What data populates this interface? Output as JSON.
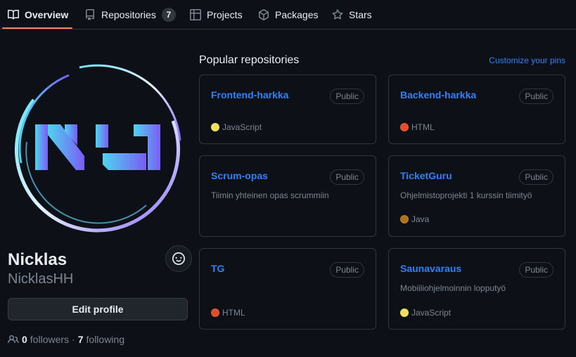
{
  "nav": {
    "tabs": [
      {
        "label": "Overview",
        "icon": "book-icon",
        "active": true
      },
      {
        "label": "Repositories",
        "icon": "repo-icon",
        "count": "7"
      },
      {
        "label": "Projects",
        "icon": "table-icon"
      },
      {
        "label": "Packages",
        "icon": "package-icon"
      },
      {
        "label": "Stars",
        "icon": "star-icon"
      }
    ]
  },
  "profile": {
    "avatar_text": "NJ",
    "name": "Nicklas",
    "username": "NicklasHH",
    "edit_button": "Edit profile",
    "followers_count": "0",
    "followers_label": "followers",
    "separator": "·",
    "following_count": "7",
    "following_label": "following"
  },
  "popular": {
    "title": "Popular repositories",
    "customize_label": "Customize your pins",
    "repos": [
      {
        "name": "Frontend-harkka",
        "visibility": "Public",
        "description": "",
        "language": "JavaScript",
        "lang_color": "#f1e05a"
      },
      {
        "name": "Backend-harkka",
        "visibility": "Public",
        "description": "",
        "language": "HTML",
        "lang_color": "#e34c26"
      },
      {
        "name": "Scrum-opas",
        "visibility": "Public",
        "description": "Tiimin yhteinen opas scrummiin",
        "language": "",
        "lang_color": ""
      },
      {
        "name": "TicketGuru",
        "visibility": "Public",
        "description": "Ohjelmistoprojekti 1 kurssin tiimityö",
        "language": "Java",
        "lang_color": "#b07219"
      },
      {
        "name": "TG",
        "visibility": "Public",
        "description": "",
        "language": "HTML",
        "lang_color": "#e34c26"
      },
      {
        "name": "Saunavaraus",
        "visibility": "Public",
        "description": "Mobiiliohjelmoinnin lopputyö",
        "language": "JavaScript",
        "lang_color": "#f1e05a"
      }
    ]
  },
  "colors": {
    "accent": "#2f81f7",
    "tab_underline": "#f78166",
    "avatar_gradient_start": "#4fd3f0",
    "avatar_gradient_end": "#7b5cf5"
  }
}
